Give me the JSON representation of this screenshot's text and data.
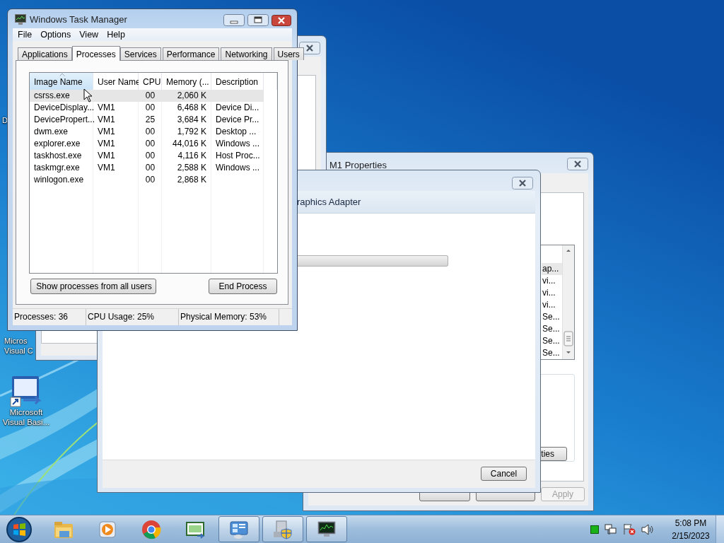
{
  "task_manager": {
    "title": "Windows Task Manager",
    "menu": [
      "File",
      "Options",
      "View",
      "Help"
    ],
    "tabs": [
      {
        "label": "Applications",
        "selected": false
      },
      {
        "label": "Processes",
        "selected": true
      },
      {
        "label": "Services",
        "selected": false
      },
      {
        "label": "Performance",
        "selected": false
      },
      {
        "label": "Networking",
        "selected": false
      },
      {
        "label": "Users",
        "selected": false
      }
    ],
    "columns": [
      {
        "label": "Image Name",
        "sorted": true
      },
      {
        "label": "User Name",
        "sorted": false
      },
      {
        "label": "CPU",
        "sorted": false
      },
      {
        "label": "Memory (...",
        "sorted": false
      },
      {
        "label": "Description",
        "sorted": false
      }
    ],
    "rows": [
      {
        "image_name": "csrss.exe",
        "cpu": "00",
        "memory": "2,060 K",
        "selected": true
      },
      {
        "image_name": "DeviceDisplay...",
        "user_name": "VM1",
        "cpu": "00",
        "memory": "6,468 K",
        "description": "Device Di...",
        "selected": false
      },
      {
        "image_name": "DevicePropert...",
        "user_name": "VM1",
        "cpu": "25",
        "memory": "3,684 K",
        "description": "Device Pr...",
        "selected": false
      },
      {
        "image_name": "dwm.exe",
        "user_name": "VM1",
        "cpu": "00",
        "memory": "1,792 K",
        "description": "Desktop ...",
        "selected": false
      },
      {
        "image_name": "explorer.exe",
        "user_name": "VM1",
        "cpu": "00",
        "memory": "44,016 K",
        "description": "Windows ...",
        "selected": false
      },
      {
        "image_name": "taskhost.exe",
        "user_name": "VM1",
        "cpu": "00",
        "memory": "4,116 K",
        "description": "Host Proc...",
        "selected": false
      },
      {
        "image_name": "taskmgr.exe",
        "user_name": "VM1",
        "cpu": "00",
        "memory": "2,588 K",
        "description": "Windows ...",
        "selected": false
      },
      {
        "image_name": "winlogon.exe",
        "cpu": "00",
        "memory": "2,868 K",
        "selected": false
      }
    ],
    "show_all_button": "Show processes from all users",
    "end_button": "End Process",
    "status_bar": [
      "Processes: 36",
      "CPU Usage: 25%",
      "Physical Memory: 53%"
    ]
  },
  "adapter_dialog": {
    "heading": "raphics Adapter",
    "progress": {
      "level": 0
    },
    "cancel_button": "Cancel"
  },
  "vm1_properties": {
    "title": "M1 Properties",
    "list_items": [
      {
        "label": "ap...",
        "selected": true
      },
      {
        "label": "vi...",
        "selected": false
      },
      {
        "label": "vi...",
        "selected": false
      },
      {
        "label": "vi...",
        "selected": false
      },
      {
        "label": "Se...",
        "selected": false
      },
      {
        "label": "Se...",
        "selected": false
      },
      {
        "label": "Se...",
        "selected": false
      },
      {
        "label": "Se...",
        "selected": false
      }
    ],
    "group_button": "ties",
    "buttons": [
      {
        "disabled": false
      },
      {
        "disabled": false
      },
      {
        "label": "Apply",
        "disabled": true
      }
    ]
  },
  "desktop_icons": [
    {
      "kind": "hidden",
      "lines": [
        "D"
      ]
    },
    {
      "kind": "hidden",
      "lines": [
        "Micros",
        "Visual C"
      ]
    },
    {
      "kind": "vb",
      "lines": [
        "Microsoft",
        "Visual Basi..."
      ]
    }
  ],
  "taskbar": {
    "items": [
      {
        "kind": "folder",
        "running": false
      },
      {
        "kind": "media",
        "running": false
      },
      {
        "kind": "chrome",
        "running": false
      },
      {
        "kind": "csharp",
        "running": false
      },
      {
        "kind": "panel",
        "running": true
      },
      {
        "kind": "device",
        "running": true
      },
      {
        "kind": "monitor",
        "running": true
      }
    ],
    "clock": {
      "time": "5:08 PM",
      "date": "2/15/2023"
    }
  }
}
